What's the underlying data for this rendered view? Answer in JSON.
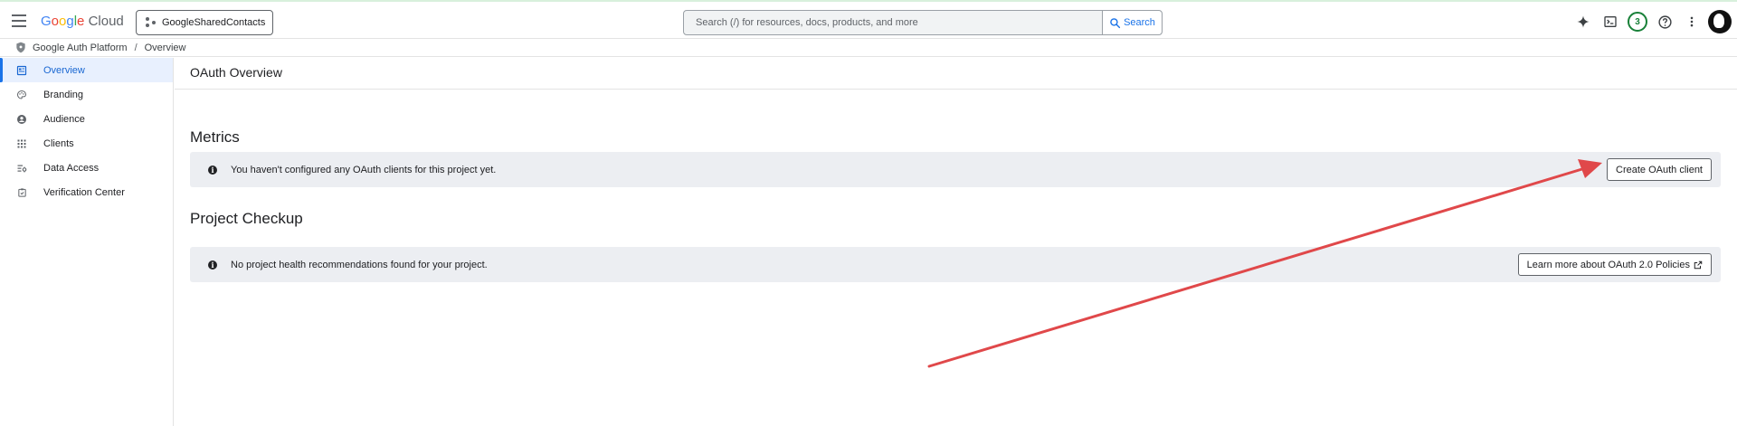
{
  "header": {
    "logo_google": "Google",
    "logo_cloud": "Cloud",
    "project_name": "GoogleSharedContacts",
    "search_placeholder": "Search (/) for resources, docs, products, and more",
    "search_button": "Search",
    "notifications_count": "3",
    "icons": [
      "menu-icon",
      "gemini-sparkle-icon",
      "cloud-shell-icon",
      "help-icon",
      "more-vert-icon",
      "avatar"
    ]
  },
  "breadcrumb": {
    "items": [
      "Google Auth Platform",
      "Overview"
    ],
    "separator": "/"
  },
  "sidebar": {
    "items": [
      {
        "label": "Overview",
        "icon": "dashboard-icon",
        "active": true
      },
      {
        "label": "Branding",
        "icon": "palette-icon",
        "active": false
      },
      {
        "label": "Audience",
        "icon": "account-circle-icon",
        "active": false
      },
      {
        "label": "Clients",
        "icon": "apps-grid-icon",
        "active": false
      },
      {
        "label": "Data Access",
        "icon": "data-access-icon",
        "active": false
      },
      {
        "label": "Verification Center",
        "icon": "verification-icon",
        "active": false
      }
    ]
  },
  "main": {
    "page_title": "OAuth Overview",
    "metrics": {
      "title": "Metrics",
      "message": "You haven't configured any OAuth clients for this project yet.",
      "button": "Create OAuth client"
    },
    "checkup": {
      "title": "Project Checkup",
      "message": "No project health recommendations found for your project.",
      "button": "Learn more about OAuth 2.0 Policies"
    }
  },
  "colors": {
    "accent": "#1a73e8",
    "active_bg": "#e8f0fe",
    "info_bar_bg": "#eceef2",
    "annotation_arrow": "#e0484a",
    "notification_ring": "#188038"
  }
}
